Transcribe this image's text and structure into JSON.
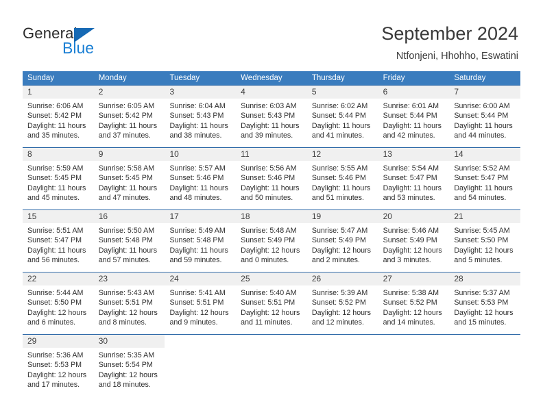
{
  "brand": {
    "name_top": "General",
    "name_bottom": "Blue",
    "triangle_icon": "blue-triangle-logo-icon",
    "color_dark": "#2b2b2b",
    "color_blue": "#1a7fd4",
    "color_triangle": "#1669b4"
  },
  "header": {
    "title": "September 2024",
    "subtitle": "Ntfonjeni, Hhohho, Eswatini"
  },
  "theme": {
    "header_row_bg": "#3a7cbe",
    "header_row_text": "#ffffff",
    "row_divider": "#2f6aa8",
    "daynum_band_bg": "#f0f0f0",
    "cell_bg": "#ffffff",
    "body_text": "#2e2e2e"
  },
  "weekdays": [
    "Sunday",
    "Monday",
    "Tuesday",
    "Wednesday",
    "Thursday",
    "Friday",
    "Saturday"
  ],
  "weeks": [
    [
      {
        "day": "1",
        "sunrise": "Sunrise: 6:06 AM",
        "sunset": "Sunset: 5:42 PM",
        "daylight_1": "Daylight: 11 hours",
        "daylight_2": "and 35 minutes."
      },
      {
        "day": "2",
        "sunrise": "Sunrise: 6:05 AM",
        "sunset": "Sunset: 5:42 PM",
        "daylight_1": "Daylight: 11 hours",
        "daylight_2": "and 37 minutes."
      },
      {
        "day": "3",
        "sunrise": "Sunrise: 6:04 AM",
        "sunset": "Sunset: 5:43 PM",
        "daylight_1": "Daylight: 11 hours",
        "daylight_2": "and 38 minutes."
      },
      {
        "day": "4",
        "sunrise": "Sunrise: 6:03 AM",
        "sunset": "Sunset: 5:43 PM",
        "daylight_1": "Daylight: 11 hours",
        "daylight_2": "and 39 minutes."
      },
      {
        "day": "5",
        "sunrise": "Sunrise: 6:02 AM",
        "sunset": "Sunset: 5:44 PM",
        "daylight_1": "Daylight: 11 hours",
        "daylight_2": "and 41 minutes."
      },
      {
        "day": "6",
        "sunrise": "Sunrise: 6:01 AM",
        "sunset": "Sunset: 5:44 PM",
        "daylight_1": "Daylight: 11 hours",
        "daylight_2": "and 42 minutes."
      },
      {
        "day": "7",
        "sunrise": "Sunrise: 6:00 AM",
        "sunset": "Sunset: 5:44 PM",
        "daylight_1": "Daylight: 11 hours",
        "daylight_2": "and 44 minutes."
      }
    ],
    [
      {
        "day": "8",
        "sunrise": "Sunrise: 5:59 AM",
        "sunset": "Sunset: 5:45 PM",
        "daylight_1": "Daylight: 11 hours",
        "daylight_2": "and 45 minutes."
      },
      {
        "day": "9",
        "sunrise": "Sunrise: 5:58 AM",
        "sunset": "Sunset: 5:45 PM",
        "daylight_1": "Daylight: 11 hours",
        "daylight_2": "and 47 minutes."
      },
      {
        "day": "10",
        "sunrise": "Sunrise: 5:57 AM",
        "sunset": "Sunset: 5:46 PM",
        "daylight_1": "Daylight: 11 hours",
        "daylight_2": "and 48 minutes."
      },
      {
        "day": "11",
        "sunrise": "Sunrise: 5:56 AM",
        "sunset": "Sunset: 5:46 PM",
        "daylight_1": "Daylight: 11 hours",
        "daylight_2": "and 50 minutes."
      },
      {
        "day": "12",
        "sunrise": "Sunrise: 5:55 AM",
        "sunset": "Sunset: 5:46 PM",
        "daylight_1": "Daylight: 11 hours",
        "daylight_2": "and 51 minutes."
      },
      {
        "day": "13",
        "sunrise": "Sunrise: 5:54 AM",
        "sunset": "Sunset: 5:47 PM",
        "daylight_1": "Daylight: 11 hours",
        "daylight_2": "and 53 minutes."
      },
      {
        "day": "14",
        "sunrise": "Sunrise: 5:52 AM",
        "sunset": "Sunset: 5:47 PM",
        "daylight_1": "Daylight: 11 hours",
        "daylight_2": "and 54 minutes."
      }
    ],
    [
      {
        "day": "15",
        "sunrise": "Sunrise: 5:51 AM",
        "sunset": "Sunset: 5:47 PM",
        "daylight_1": "Daylight: 11 hours",
        "daylight_2": "and 56 minutes."
      },
      {
        "day": "16",
        "sunrise": "Sunrise: 5:50 AM",
        "sunset": "Sunset: 5:48 PM",
        "daylight_1": "Daylight: 11 hours",
        "daylight_2": "and 57 minutes."
      },
      {
        "day": "17",
        "sunrise": "Sunrise: 5:49 AM",
        "sunset": "Sunset: 5:48 PM",
        "daylight_1": "Daylight: 11 hours",
        "daylight_2": "and 59 minutes."
      },
      {
        "day": "18",
        "sunrise": "Sunrise: 5:48 AM",
        "sunset": "Sunset: 5:49 PM",
        "daylight_1": "Daylight: 12 hours",
        "daylight_2": "and 0 minutes."
      },
      {
        "day": "19",
        "sunrise": "Sunrise: 5:47 AM",
        "sunset": "Sunset: 5:49 PM",
        "daylight_1": "Daylight: 12 hours",
        "daylight_2": "and 2 minutes."
      },
      {
        "day": "20",
        "sunrise": "Sunrise: 5:46 AM",
        "sunset": "Sunset: 5:49 PM",
        "daylight_1": "Daylight: 12 hours",
        "daylight_2": "and 3 minutes."
      },
      {
        "day": "21",
        "sunrise": "Sunrise: 5:45 AM",
        "sunset": "Sunset: 5:50 PM",
        "daylight_1": "Daylight: 12 hours",
        "daylight_2": "and 5 minutes."
      }
    ],
    [
      {
        "day": "22",
        "sunrise": "Sunrise: 5:44 AM",
        "sunset": "Sunset: 5:50 PM",
        "daylight_1": "Daylight: 12 hours",
        "daylight_2": "and 6 minutes."
      },
      {
        "day": "23",
        "sunrise": "Sunrise: 5:43 AM",
        "sunset": "Sunset: 5:51 PM",
        "daylight_1": "Daylight: 12 hours",
        "daylight_2": "and 8 minutes."
      },
      {
        "day": "24",
        "sunrise": "Sunrise: 5:41 AM",
        "sunset": "Sunset: 5:51 PM",
        "daylight_1": "Daylight: 12 hours",
        "daylight_2": "and 9 minutes."
      },
      {
        "day": "25",
        "sunrise": "Sunrise: 5:40 AM",
        "sunset": "Sunset: 5:51 PM",
        "daylight_1": "Daylight: 12 hours",
        "daylight_2": "and 11 minutes."
      },
      {
        "day": "26",
        "sunrise": "Sunrise: 5:39 AM",
        "sunset": "Sunset: 5:52 PM",
        "daylight_1": "Daylight: 12 hours",
        "daylight_2": "and 12 minutes."
      },
      {
        "day": "27",
        "sunrise": "Sunrise: 5:38 AM",
        "sunset": "Sunset: 5:52 PM",
        "daylight_1": "Daylight: 12 hours",
        "daylight_2": "and 14 minutes."
      },
      {
        "day": "28",
        "sunrise": "Sunrise: 5:37 AM",
        "sunset": "Sunset: 5:53 PM",
        "daylight_1": "Daylight: 12 hours",
        "daylight_2": "and 15 minutes."
      }
    ],
    [
      {
        "day": "29",
        "sunrise": "Sunrise: 5:36 AM",
        "sunset": "Sunset: 5:53 PM",
        "daylight_1": "Daylight: 12 hours",
        "daylight_2": "and 17 minutes."
      },
      {
        "day": "30",
        "sunrise": "Sunrise: 5:35 AM",
        "sunset": "Sunset: 5:54 PM",
        "daylight_1": "Daylight: 12 hours",
        "daylight_2": "and 18 minutes."
      },
      {
        "day": "",
        "sunrise": "",
        "sunset": "",
        "daylight_1": "",
        "daylight_2": ""
      },
      {
        "day": "",
        "sunrise": "",
        "sunset": "",
        "daylight_1": "",
        "daylight_2": ""
      },
      {
        "day": "",
        "sunrise": "",
        "sunset": "",
        "daylight_1": "",
        "daylight_2": ""
      },
      {
        "day": "",
        "sunrise": "",
        "sunset": "",
        "daylight_1": "",
        "daylight_2": ""
      },
      {
        "day": "",
        "sunrise": "",
        "sunset": "",
        "daylight_1": "",
        "daylight_2": ""
      }
    ]
  ]
}
